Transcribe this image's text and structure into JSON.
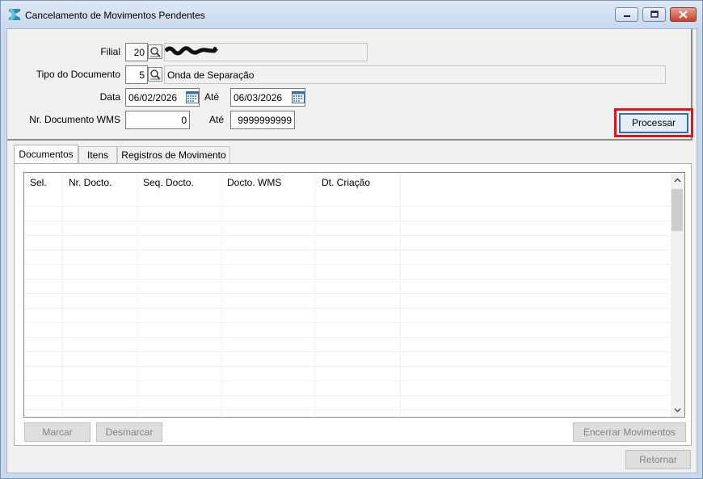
{
  "window": {
    "title": "Cancelamento de Movimentos Pendentes",
    "icons": {
      "app": "app-logo-icon",
      "minimize": "minimize-icon",
      "maximize": "maximize-icon",
      "close": "close-icon"
    }
  },
  "filters": {
    "filial": {
      "label": "Filial",
      "value": "20",
      "description": ""
    },
    "tipo_documento": {
      "label": "Tipo do Documento",
      "value": "5",
      "description": "Onda de Separação"
    },
    "data": {
      "label": "Data",
      "from": "06/02/2026",
      "to_label": "Até",
      "to": "06/03/2026"
    },
    "nr_documento_wms": {
      "label": "Nr. Documento WMS",
      "from": "0",
      "to_label": "Até",
      "to": "9999999999"
    }
  },
  "buttons": {
    "processar": "Processar",
    "marcar": "Marcar",
    "desmarcar": "Desmarcar",
    "encerrar": "Encerrar Movimentos",
    "retornar": "Retornar"
  },
  "tabs": [
    {
      "label": "Documentos",
      "active": true
    },
    {
      "label": "Itens",
      "active": false
    },
    {
      "label": "Registros de Movimento",
      "active": false
    }
  ],
  "grid": {
    "columns": [
      "Sel.",
      "Nr. Docto.",
      "Seq. Docto.",
      "Docto. WMS",
      "Dt. Criação"
    ],
    "rows": []
  },
  "colors": {
    "highlight": "#e01515",
    "accent": "#2f6fb5"
  }
}
